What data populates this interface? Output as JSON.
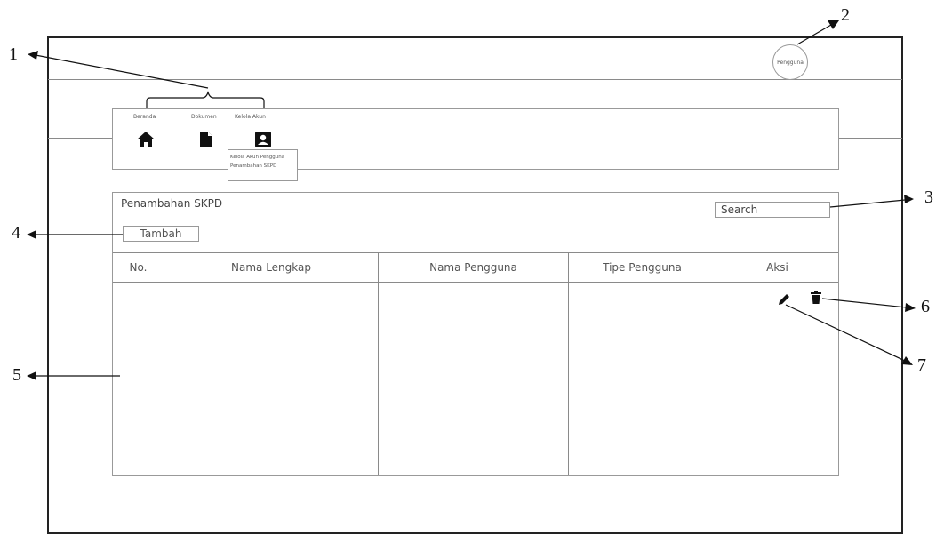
{
  "header": {
    "avatar_label": "Pengguna"
  },
  "nav": {
    "items": [
      {
        "label": "Beranda",
        "icon": "home-icon"
      },
      {
        "label": "Dokumen",
        "icon": "document-icon"
      },
      {
        "label": "Kelola Akun",
        "icon": "account-icon"
      }
    ],
    "submenu": [
      "Kelola Akun Pengguna",
      "Penambahan SKPD"
    ]
  },
  "content": {
    "title": "Penambahan SKPD",
    "add_button": "Tambah",
    "search_placeholder": "Search",
    "table": {
      "columns": [
        "No.",
        "Nama Lengkap",
        "Nama Pengguna",
        "Tipe Pengguna",
        "Aksi"
      ],
      "row_actions": [
        "edit-icon",
        "delete-icon"
      ]
    }
  },
  "callouts": [
    "1",
    "2",
    "3",
    "4",
    "5",
    "6",
    "7"
  ]
}
